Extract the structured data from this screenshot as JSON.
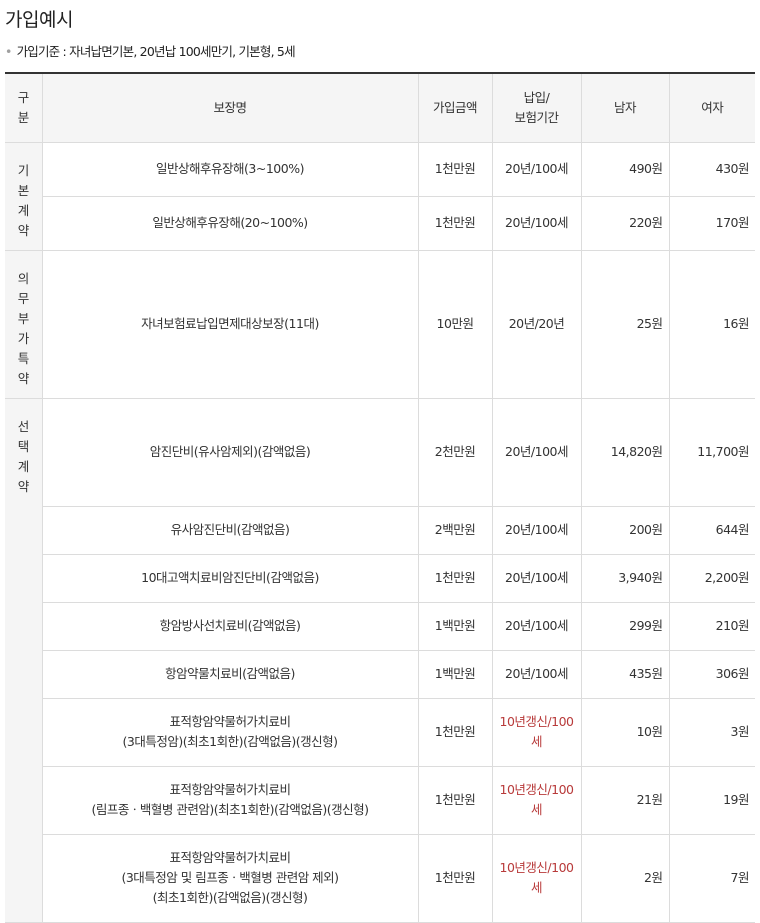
{
  "title": "가입예시",
  "criteria": "가입기준 : 자녀납면기본, 20년납 100세만기, 기본형, 5세",
  "table": {
    "headers": {
      "category": [
        "구",
        "분"
      ],
      "coverage": "보장명",
      "amount": "가입금액",
      "period": [
        "납입/",
        "보험기간"
      ],
      "male": "남자",
      "female": "여자"
    },
    "groups": [
      {
        "category": [
          "기",
          "본",
          "계",
          "약"
        ],
        "rows": [
          {
            "name": [
              "일반상해후유장해(3~100%)"
            ],
            "amount": "1천만원",
            "period": "20년/100세",
            "male": "490원",
            "female": "430원",
            "height": 54
          },
          {
            "name": [
              "일반상해후유장해(20~100%)"
            ],
            "amount": "1천만원",
            "period": "20년/100세",
            "male": "220원",
            "female": "170원",
            "height": 54
          }
        ]
      },
      {
        "category": [
          "의",
          "무",
          "부",
          "가",
          "특",
          "약"
        ],
        "rows": [
          {
            "name": [
              "자녀보험료납입면제대상보장(11대)"
            ],
            "amount": "10만원",
            "period": "20년/20년",
            "male": "25원",
            "female": "16원",
            "height": 148
          }
        ]
      },
      {
        "category": [
          "선",
          "택",
          "계",
          "약"
        ],
        "rows": [
          {
            "name": [
              "암진단비(유사암제외)(감액없음)"
            ],
            "amount": "2천만원",
            "period": "20년/100세",
            "male": "14,820원",
            "female": "11,700원",
            "height": 108
          },
          {
            "name": [
              "유사암진단비(감액없음)"
            ],
            "amount": "2백만원",
            "period": "20년/100세",
            "male": "200원",
            "female": "644원",
            "height": 48
          },
          {
            "name": [
              "10대고액치료비암진단비(감액없음)"
            ],
            "amount": "1천만원",
            "period": "20년/100세",
            "male": "3,940원",
            "female": "2,200원",
            "height": 48
          },
          {
            "name": [
              "항암방사선치료비(감액없음)"
            ],
            "amount": "1백만원",
            "period": "20년/100세",
            "male": "299원",
            "female": "210원",
            "height": 48
          },
          {
            "name": [
              "항암약물치료비(감액없음)"
            ],
            "amount": "1백만원",
            "period": "20년/100세",
            "male": "435원",
            "female": "306원",
            "height": 48
          },
          {
            "name": [
              "표적항암약물허가치료비",
              "(3대특정암)(최초1회한)(감액없음)(갱신형)"
            ],
            "amount": "1천만원",
            "period": "10년갱신/100세",
            "period_red": true,
            "male": "10원",
            "female": "3원",
            "height": 68
          },
          {
            "name": [
              "표적항암약물허가치료비",
              "(림프종ㆍ백혈병 관련암)(최초1회한)(감액없음)(갱신형)"
            ],
            "amount": "1천만원",
            "period": "10년갱신/100세",
            "period_red": true,
            "male": "21원",
            "female": "19원",
            "height": 68
          },
          {
            "name": [
              "표적항암약물허가치료비",
              "(3대특정암 및 림프종ㆍ백혈병 관련암 제외)",
              "(최초1회한)(감액없음)(갱신형)"
            ],
            "amount": "1천만원",
            "period": "10년갱신/100세",
            "period_red": true,
            "male": "2원",
            "female": "7원",
            "height": 88
          }
        ]
      }
    ]
  }
}
